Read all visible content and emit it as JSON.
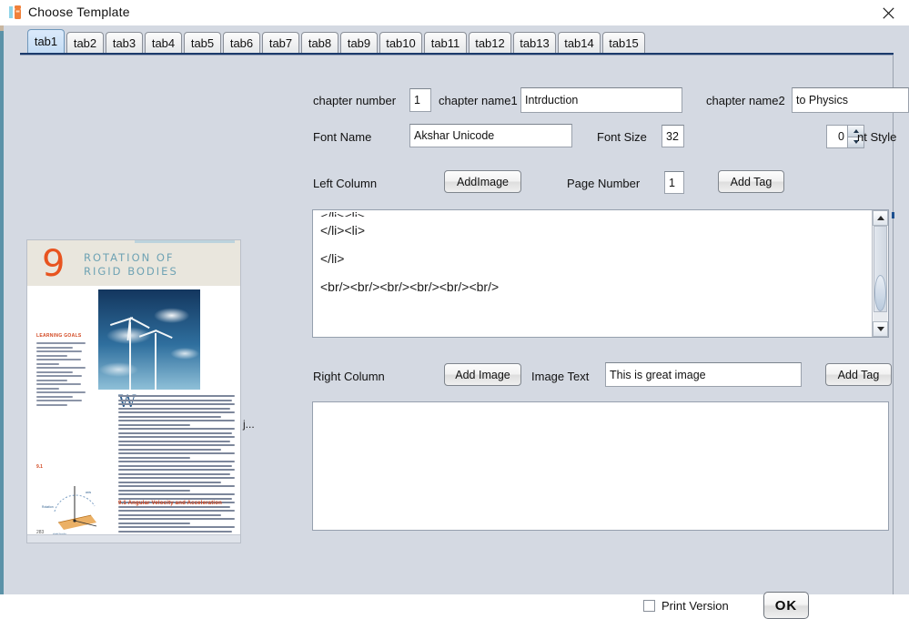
{
  "window": {
    "title": "Choose Template",
    "close_label": "✕",
    "icon_name": "app-logo-icon"
  },
  "tabs": {
    "selected": "tab1",
    "items": [
      {
        "label": "tab1"
      },
      {
        "label": "tab2"
      },
      {
        "label": "tab3"
      },
      {
        "label": "tab4"
      },
      {
        "label": "tab5"
      },
      {
        "label": "tab6"
      },
      {
        "label": "tab7"
      },
      {
        "label": "tab8"
      },
      {
        "label": "tab9"
      },
      {
        "label": "tab10"
      },
      {
        "label": "tab11"
      },
      {
        "label": "tab12"
      },
      {
        "label": "tab13"
      },
      {
        "label": "tab14"
      },
      {
        "label": "tab15"
      }
    ]
  },
  "form": {
    "chapter_number_label": "chapter number",
    "chapter_number_value": "1",
    "chapter_name1_label": "chapter name1",
    "chapter_name1_value": "Intrduction",
    "chapter_name2_label": "chapter name2",
    "chapter_name2_value": "to Physics",
    "font_name_label": "Font Name",
    "font_name_value": "Akshar Unicode",
    "font_size_label": "Font Size",
    "font_size_value": "32",
    "font_style_label": "nt Style",
    "font_style_value": "0"
  },
  "left_column": {
    "label": "Left Column",
    "add_image_label": "AddImage",
    "page_number_label": "Page Number",
    "page_number_value": "1",
    "add_tag_label": "Add Tag",
    "textarea_lines": [
      "</li><li>",
      "</li><li>",
      "</li>",
      "<br/><br/><br/><br/><br/><br/>"
    ]
  },
  "right_column": {
    "label": "Right Column",
    "add_image_label": "Add Image",
    "image_text_label": "Image Text",
    "image_text_value": "This is great image",
    "add_tag_label": "Add Tag",
    "textarea_value": ""
  },
  "footer": {
    "print_version_label": "Print Version",
    "print_version_checked": false,
    "ok_label": "OK"
  },
  "preview": {
    "chapter_number": "9",
    "title_line1": "ROTATION OF",
    "title_line2": "RIGID BODIES",
    "learning_goals_heading": "LEARNING GOALS",
    "figure_caption": "9.1",
    "section_heading": "9.1   Angular Velocity and Acceleration",
    "page_number": "283",
    "truncated_label": "j..."
  },
  "colors": {
    "window_background": "#d4d9e2",
    "titlebar_background": "#ffffff",
    "tab_selected": "#c4dcf4",
    "tab_underline": "#1b3a6b",
    "left_edge": "#5b92a8",
    "field_background": "#ffffff",
    "preview_accent_orange": "#e8541f",
    "preview_accent_teal": "#6fa3b4"
  }
}
